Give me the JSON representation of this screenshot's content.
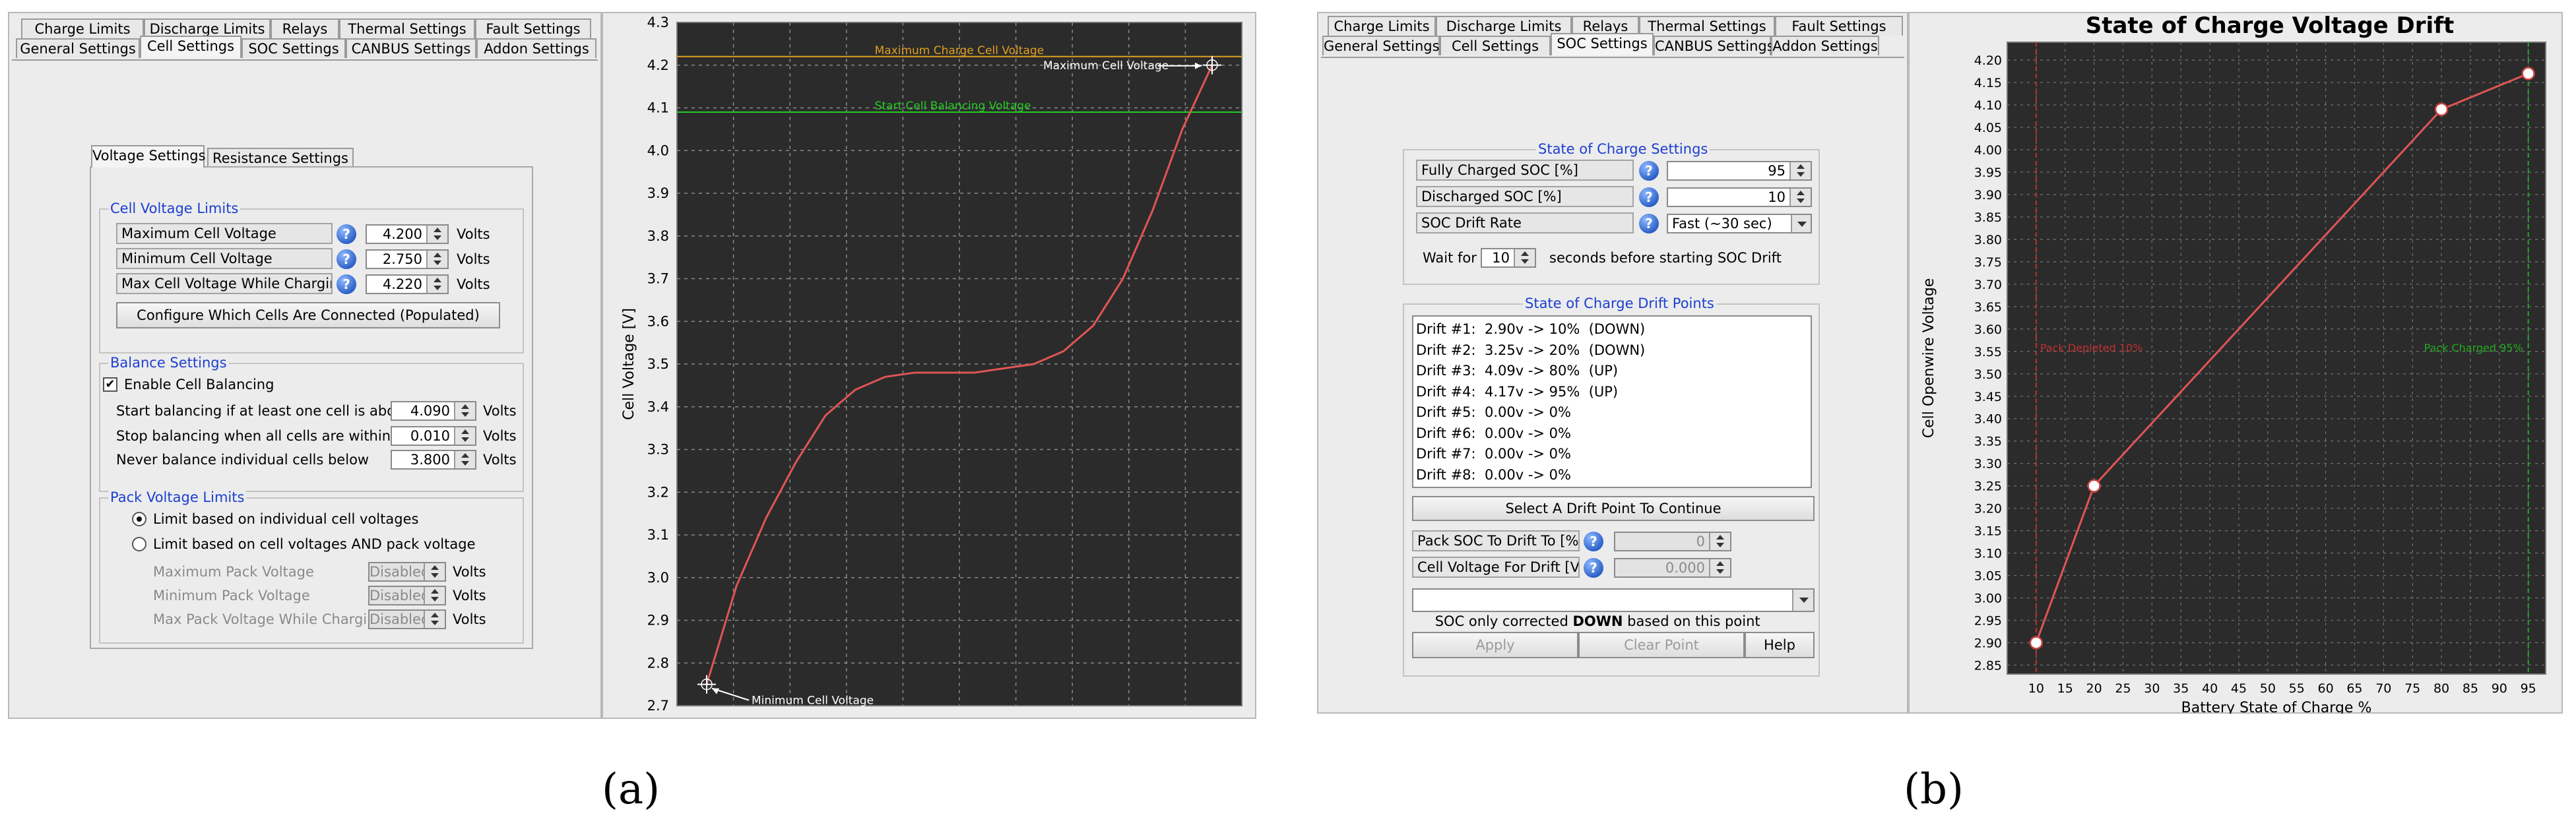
{
  "captions": {
    "a": "(a)",
    "b": "(b)"
  },
  "colors": {
    "panel": "#ececec",
    "group_title": "#1c3fd0",
    "chart_bg": "#2b2b2b",
    "curve": "#e05555",
    "max_charge_line": "#e0a020",
    "balance_line": "#22cc22",
    "help_icon": "#2d63c8"
  },
  "left": {
    "tabs_row1": [
      "Charge Limits",
      "Discharge Limits",
      "Relays",
      "Thermal Settings",
      "Fault Settings"
    ],
    "tabs_row2": [
      "General Settings",
      "Cell Settings",
      "SOC Settings",
      "CANBUS Settings",
      "Addon Settings"
    ],
    "selected_tab": "Cell Settings",
    "subtabs": [
      "Voltage Settings",
      "Resistance Settings"
    ],
    "cell_limits": {
      "title": "Cell Voltage Limits",
      "rows": [
        {
          "label": "Maximum Cell Voltage",
          "value": "4.200",
          "unit": "Volts"
        },
        {
          "label": "Minimum Cell Voltage",
          "value": "2.750",
          "unit": "Volts"
        },
        {
          "label": "Max Cell Voltage While Charging",
          "value": "4.220",
          "unit": "Volts"
        }
      ],
      "configure_button": "Configure Which Cells Are Connected (Populated)"
    },
    "balance": {
      "title": "Balance Settings",
      "enable_label": "Enable Cell Balancing",
      "enabled": "✔",
      "rows": [
        {
          "label": "Start balancing if at least one cell is above",
          "value": "4.090",
          "unit": "Volts"
        },
        {
          "label": "Stop balancing when all cells are within",
          "value": "0.010",
          "unit": "Volts"
        },
        {
          "label": "Never balance individual cells below",
          "value": "3.800",
          "unit": "Volts"
        }
      ]
    },
    "pack": {
      "title": "Pack Voltage Limits",
      "radio1": "Limit based on individual cell voltages",
      "radio2": "Limit based on cell voltages AND pack voltage",
      "rows": [
        {
          "label": "Maximum Pack Voltage",
          "value": "Disabled",
          "unit": "Volts"
        },
        {
          "label": "Minimum Pack Voltage",
          "value": "Disabled",
          "unit": "Volts"
        },
        {
          "label": "Max Pack Voltage While Charging",
          "value": "Disabled",
          "unit": "Volts"
        }
      ]
    }
  },
  "right": {
    "tabs_row1": [
      "Charge Limits",
      "Discharge Limits",
      "Relays",
      "Thermal Settings",
      "Fault Settings"
    ],
    "tabs_row2": [
      "General Settings",
      "Cell Settings",
      "SOC Settings",
      "CANBUS Settings",
      "Addon Settings"
    ],
    "selected_tab": "SOC Settings",
    "soc": {
      "title": "State of Charge Settings",
      "rows": [
        {
          "label": "Fully Charged SOC [%]",
          "value": "95"
        },
        {
          "label": "Discharged SOC [%]",
          "value": "10"
        }
      ],
      "drift_rate_label": "SOC Drift Rate",
      "drift_rate_value": "Fast (~30 sec)",
      "wait_prefix": "Wait for",
      "wait_value": "10",
      "wait_suffix": "seconds before starting SOC Drift"
    },
    "drift": {
      "title": "State of Charge Drift Points",
      "items": [
        "Drift #1:  2.90v -> 10%  (DOWN)",
        "Drift #2:  3.25v -> 20%  (DOWN)",
        "Drift #3:  4.09v -> 80%  (UP)",
        "Drift #4:  4.17v -> 95%  (UP)",
        "Drift #5:  0.00v -> 0%",
        "Drift #6:  0.00v -> 0%",
        "Drift #7:  0.00v -> 0%",
        "Drift #8:  0.00v -> 0%"
      ],
      "select_button": "Select A Drift Point To Continue",
      "pack_soc_label": "Pack SOC To Drift To [%]",
      "pack_soc_value": "0",
      "cell_v_label": "Cell Voltage For Drift [V]",
      "cell_v_value": "0.000",
      "dropdown_prefix": "SOC only corrected ",
      "dropdown_bold": "DOWN",
      "dropdown_suffix": " based on this point",
      "apply": "Apply",
      "clear": "Clear Point",
      "help": "Help"
    }
  },
  "chart_data": [
    {
      "type": "line",
      "title": "",
      "xlabel": "",
      "ylabel": "Cell Voltage [V]",
      "ylim": [
        2.7,
        4.3
      ],
      "yticks": [
        "2.7",
        "2.8",
        "2.9",
        "3.0",
        "3.1",
        "3.2",
        "3.3",
        "3.4",
        "3.5",
        "3.6",
        "3.7",
        "3.8",
        "3.9",
        "4.0",
        "4.1",
        "4.2",
        "4.3"
      ],
      "grid": true,
      "x": [
        0,
        5,
        10,
        15,
        20,
        25,
        30,
        35,
        40,
        45,
        50,
        55,
        60,
        65,
        70,
        75,
        80,
        85,
        90,
        95,
        100
      ],
      "series": [
        {
          "values": [
            2.75,
            2.98,
            3.14,
            3.27,
            3.38,
            3.44,
            3.47,
            3.48,
            3.48,
            3.48,
            3.49,
            3.5,
            3.53,
            3.59,
            3.7,
            3.86,
            4.05,
            4.2
          ]
        }
      ],
      "reference_lines": [
        {
          "label": "Maximum Charge Cell Voltage",
          "y": 4.22
        },
        {
          "label": "Start Cell Balancing Voltage",
          "y": 4.09
        }
      ],
      "annotations": [
        "Maximum Cell Voltage",
        "Minimum Cell Voltage"
      ]
    },
    {
      "type": "line",
      "title": "State of Charge Voltage Drift",
      "xlabel": "Battery State of Charge %",
      "ylabel": "Cell Openwire Voltage",
      "xlim": [
        5,
        98
      ],
      "ylim": [
        2.83,
        4.24
      ],
      "xticks": [
        "10",
        "15",
        "20",
        "25",
        "30",
        "35",
        "40",
        "45",
        "50",
        "55",
        "60",
        "65",
        "70",
        "75",
        "80",
        "85",
        "90",
        "95"
      ],
      "yticks": [
        "2.85",
        "2.90",
        "2.95",
        "3.00",
        "3.05",
        "3.10",
        "3.15",
        "3.20",
        "3.25",
        "3.30",
        "3.35",
        "3.40",
        "3.45",
        "3.50",
        "3.55",
        "3.60",
        "3.65",
        "3.70",
        "3.75",
        "3.80",
        "3.85",
        "3.90",
        "3.95",
        "4.00",
        "4.05",
        "4.10",
        "4.15",
        "4.20"
      ],
      "grid": true,
      "points": [
        {
          "x": 10,
          "y": 2.9
        },
        {
          "x": 20,
          "y": 3.25
        },
        {
          "x": 80,
          "y": 4.09
        },
        {
          "x": 95,
          "y": 4.17
        }
      ],
      "reference_lines": [
        {
          "label": "Pack Depleted 10%",
          "x": 10
        },
        {
          "label": "Pack Charged 95%",
          "x": 95
        }
      ]
    }
  ]
}
